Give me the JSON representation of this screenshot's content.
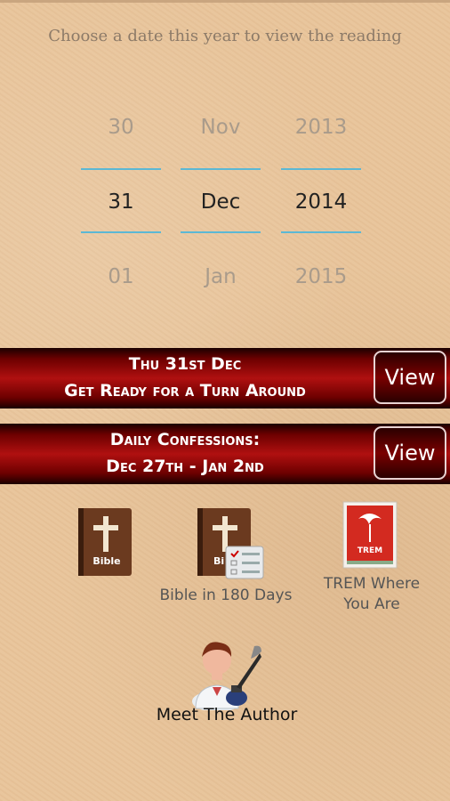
{
  "prompt": "Choose a date this year to view the reading",
  "picker": {
    "day": {
      "prev": "30",
      "current": "31",
      "next": "01"
    },
    "month": {
      "prev": "Nov",
      "current": "Dec",
      "next": "Jan"
    },
    "year": {
      "prev": "2013",
      "current": "2014",
      "next": "2015"
    }
  },
  "banners": [
    {
      "line1": "Thu 31st Dec",
      "line2": "Get Ready for a Turn Around",
      "button": "View"
    },
    {
      "line1": "Daily Confessions:",
      "line2": "Dec 27th - Jan 2nd",
      "button": "View"
    }
  ],
  "tiles": {
    "bible": {
      "cover_text": "Bible"
    },
    "bible180": {
      "label": "Bible in 180 Days",
      "cover_text": "Bi"
    },
    "trem": {
      "label1": "TREM Where",
      "label2": "You Are",
      "logo_text": "TREM"
    },
    "author": {
      "label": "Meet The Author"
    }
  },
  "colors": {
    "accent": "#5cb8d4",
    "banner": "#b01010",
    "background": "#e8c49a"
  }
}
